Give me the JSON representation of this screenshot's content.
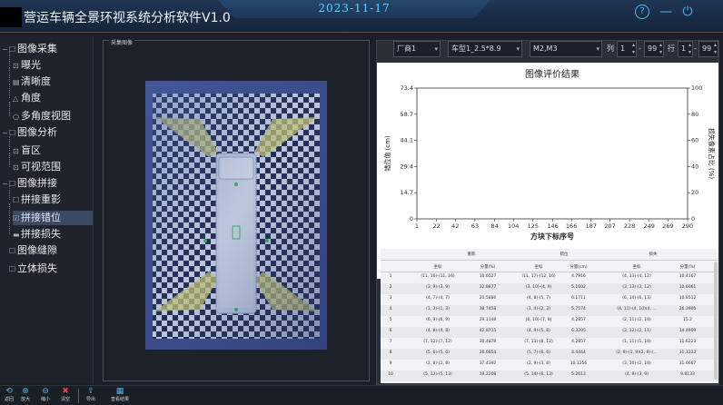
{
  "window": {
    "title": "营运车辆全景环视系统分析软件V1.0",
    "date": "2023-11-17",
    "icons": [
      "help-icon",
      "minimize-icon",
      "power-icon"
    ],
    "help_glyph": "?",
    "min_glyph": "—",
    "power_glyph": "⏻",
    "accent": "#4cb7f2"
  },
  "tree": [
    {
      "label": "图像采集",
      "level": 0,
      "toggle": "−",
      "icon": "☐"
    },
    {
      "label": "曝光",
      "level": 1,
      "icon": "⊡"
    },
    {
      "label": "清晰度",
      "level": 1,
      "icon": "▤"
    },
    {
      "label": "角度",
      "level": 1,
      "icon": "△"
    },
    {
      "label": "多角度视图",
      "level": 1,
      "icon": "○"
    },
    {
      "label": "图像分析",
      "level": 0,
      "toggle": "−",
      "icon": "☐"
    },
    {
      "label": "盲区",
      "level": 1,
      "icon": "⊡"
    },
    {
      "label": "可视范围",
      "level": 1,
      "icon": "⊡"
    },
    {
      "label": "图像拼接",
      "level": 0,
      "toggle": "−",
      "icon": "☐"
    },
    {
      "label": "拼接重影",
      "level": 1,
      "icon": "☐"
    },
    {
      "label": "拼接错位",
      "level": 1,
      "icon": "☑",
      "selected": true
    },
    {
      "label": "拼接损失",
      "level": 1,
      "icon": "▬"
    },
    {
      "label": "图像缝隙",
      "level": 0,
      "toggle": "",
      "icon": "☐"
    },
    {
      "label": "立体损失",
      "level": 0,
      "toggle": "",
      "icon": "☐"
    }
  ],
  "image_panel": {
    "title": "采集图像"
  },
  "filters": {
    "vendor": "厂商1",
    "model": "车型1_2.5*8.9",
    "camera": "M2,M3",
    "col_label": "列",
    "col_from": "1",
    "col_to": "99",
    "row_label": "行",
    "row_from": "1",
    "row_to": "99",
    "dash": "-"
  },
  "chart_data": {
    "type": "line",
    "title": "图像评价结果",
    "xlabel": "方块下标序号",
    "ylabel": "错位值 (cm)",
    "y2label": "损失像素占比 (%)",
    "xticks": [
      1,
      22,
      42,
      63,
      84,
      104,
      125,
      146,
      166,
      187,
      207,
      228,
      249,
      269,
      290
    ],
    "yticks": [
      0.0,
      14.7,
      29.4,
      44.1,
      58.7,
      73.4
    ],
    "y2ticks": [
      0.0,
      20.0,
      40.0,
      60.0,
      80.0,
      100.0
    ],
    "ylim": [
      0,
      73.4
    ],
    "y2lim": [
      0,
      100
    ],
    "xlim": [
      1,
      290
    ],
    "grid": false,
    "series_color": "#3aa6dc",
    "line_color": "#9aa0a6"
  },
  "table": {
    "groups": [
      "重影",
      "错位",
      "损失"
    ],
    "subheaders": [
      "坐标",
      "分量(%)",
      "坐标",
      "分量(cm)",
      "坐标",
      "分量(%)"
    ],
    "rows": [
      [
        "1",
        "(11, 16)-(11, 16)",
        "10.6527",
        "(11, 17)-(12, 16)",
        "4.7916",
        "(4, 13)-(4, 12)",
        "10.4167"
      ],
      [
        "2",
        "(3, 9)-(3, 9)",
        "32.8877",
        "(3, 10)-(4, 9)",
        "5.1602",
        "(3, 13)-(3, 12)",
        "10.6061"
      ],
      [
        "3",
        "(4, 7)-(4, 7)",
        "20.5886",
        "(4, 8)-(5, 7)",
        "6.1711",
        "(6, 14)-(6, 13)",
        "10.8512"
      ],
      [
        "4",
        "(1, 3)-(1, 3)",
        "38.7458",
        "(1, 4)-(2, 3)",
        "5.7574",
        "(4, 11)-(4, 10)(4, ...",
        "26.3905"
      ],
      [
        "5",
        "(6, 9)-(6, 9)",
        "29.1148",
        "(6, 10)-(7, 9)",
        "4.2857",
        "(2, 11)-(2, 10)",
        "15.2"
      ],
      [
        "6",
        "(4, 8)-(4, 8)",
        "42.8715",
        "(4, 9)-(5, 8)",
        "6.3205",
        "(2, 12)-(2, 11)",
        "14.4909"
      ],
      [
        "7",
        "(7, 12)-(7, 12)",
        "30.4878",
        "(7, 13)-(8, 12)",
        "4.2857",
        "(1, 11)-(1, 10)",
        "11.6223"
      ],
      [
        "8",
        "(5, 6)-(5, 6)",
        "26.6854",
        "(5, 7)-(6, 6)",
        "4.4444",
        "(2, 9)-(1, 9)(2, 9)-(...",
        "31.3333"
      ],
      [
        "9",
        "(2, 8)-(2, 8)",
        "37.4392",
        "(2, 9)-(3, 8)",
        "10.1256",
        "(3, 10)-(2, 10)",
        "31.6667"
      ],
      [
        "10",
        "(5, 13)-(5, 13)",
        "19.2208",
        "(5, 14)-(6, 13)",
        "5.2613",
        "(4, 9)-(3, 9)",
        "9.8133"
      ]
    ]
  },
  "toolbar": [
    {
      "label": "返回",
      "icon": "back-icon",
      "glyph": "⟲"
    },
    {
      "label": "放大",
      "icon": "zoom-in-icon",
      "glyph": "⊕"
    },
    {
      "label": "缩小",
      "icon": "zoom-out-icon",
      "glyph": "⊖"
    },
    {
      "label": "清空",
      "icon": "clear-icon",
      "glyph": "✖"
    },
    {
      "label": "导出",
      "icon": "export-icon",
      "glyph": "⇪"
    },
    {
      "label": "查看结果",
      "icon": "view-result-icon",
      "glyph": "▦"
    }
  ]
}
